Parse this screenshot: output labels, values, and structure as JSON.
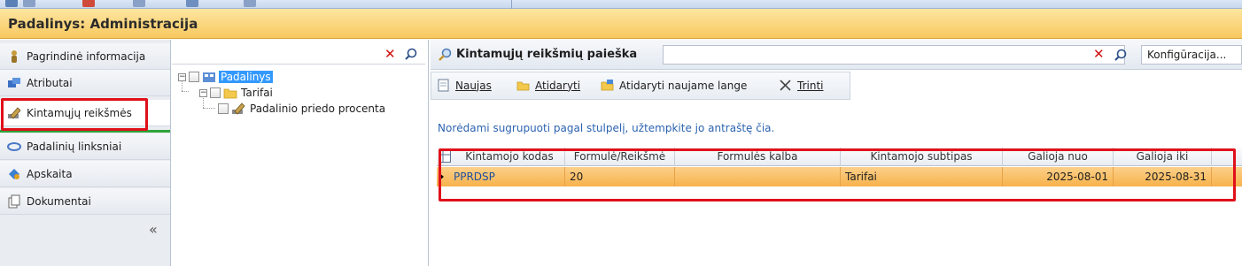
{
  "window": {
    "title": "Padalinys: Administracija"
  },
  "nav": {
    "items": [
      {
        "label": "Pagrindinė informacija",
        "icon": "person-icon"
      },
      {
        "label": "Atributai",
        "icon": "attributes-icon"
      },
      {
        "label": "Kintamųjų reikšmės",
        "icon": "edit-pencil-icon",
        "active": true
      },
      {
        "label": "Padalinių linksniai",
        "icon": "link-icon"
      },
      {
        "label": "Apskaita",
        "icon": "accounting-icon"
      },
      {
        "label": "Dokumentai",
        "icon": "documents-icon"
      }
    ],
    "collapse_glyph": "«"
  },
  "tree": {
    "search_value": "",
    "nodes": [
      {
        "label": "Padalinys",
        "level": 0,
        "selected": true
      },
      {
        "label": "Tarifai",
        "level": 1
      },
      {
        "label": "Padalinio priedo procenta",
        "level": 2
      }
    ]
  },
  "search": {
    "title": "Kintamųjų reikšmių paieška",
    "value": "",
    "config_label": "Konfigūracija..."
  },
  "toolbar": {
    "new_label": "Naujas",
    "open_label": "Atidaryti",
    "open_new_window_label": "Atidaryti naujame lange",
    "delete_label": "Trinti"
  },
  "group_hint": "Norėdami sugrupuoti pagal stulpelį, užtempkite jo antraštę čia.",
  "table": {
    "columns": [
      "Kintamojo kodas",
      "Formulė/Reikšmė",
      "Formulės kalba",
      "Kintamojo subtipas",
      "Galioja nuo",
      "Galioja iki"
    ],
    "rows": [
      [
        "PPRDSP",
        "20",
        "",
        "Tarifai",
        "2025-08-01",
        "2025-08-31"
      ]
    ]
  },
  "colors": {
    "title_bar": "#f8c860",
    "selection_row": "#f7b24b",
    "highlight_box": "#e0101a",
    "active_indicator": "#2fa33a"
  }
}
